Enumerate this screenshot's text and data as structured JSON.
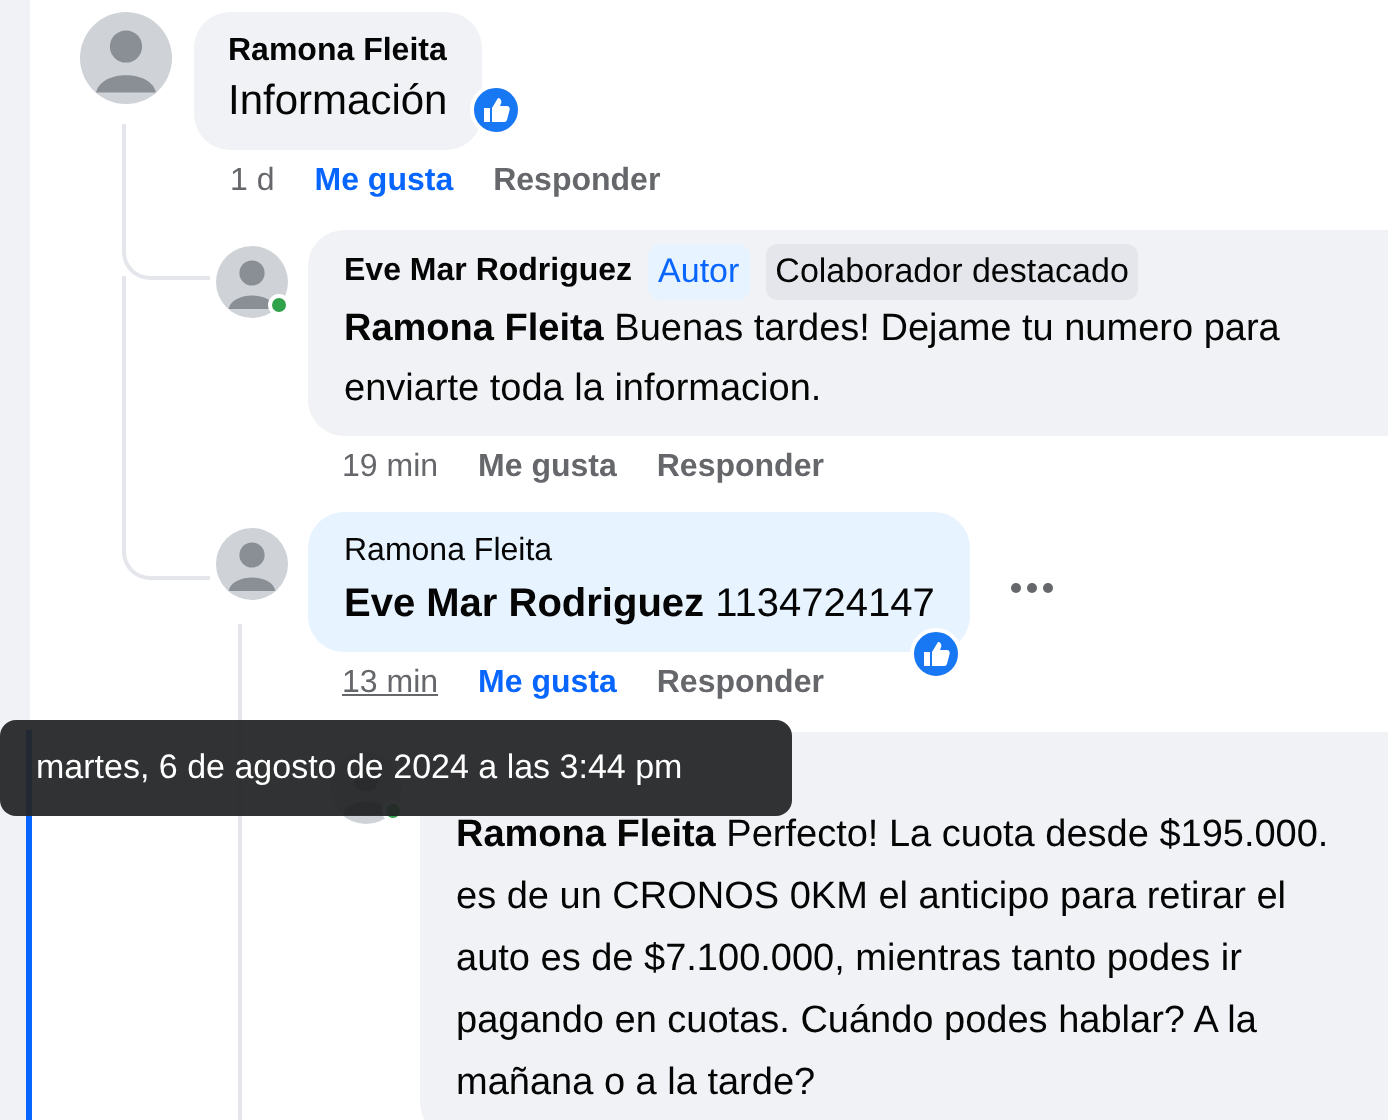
{
  "comments": [
    {
      "author": "Ramona Fleita",
      "text": "Información",
      "reacted": true,
      "time": "1 d",
      "like_label": "Me gusta",
      "liked": true,
      "reply_label": "Responder",
      "replies": [
        {
          "author": "Eve Mar Rodriguez",
          "badges": [
            {
              "label": "Autor",
              "kind": "author"
            },
            {
              "label": "Colaborador destacado",
              "kind": "contributor"
            }
          ],
          "mention": "Ramona Fleita",
          "text": "Buenas tardes! Dejame tu numero para enviarte toda la informacion.",
          "time": "19 min",
          "like_label": "Me gusta",
          "liked": false,
          "reply_label": "Responder",
          "online": true
        },
        {
          "author": "Ramona Fleita",
          "mention": "Eve Mar Rodriguez",
          "text": "1134724147",
          "reacted": true,
          "time": "13 min",
          "time_hovered": true,
          "like_label": "Me gusta",
          "liked": true,
          "reply_label": "Responder",
          "highlighted": true,
          "more_menu": true,
          "replies": [
            {
              "mention": "Ramona Fleita",
              "text": "Perfecto! La cuota desde $195.000. es de un CRONOS 0KM el anticipo para retirar el auto es de $7.100.000, mientras tanto podes ir pagando en cuotas. Cuándo podes hablar? A la mañana o a la tarde?",
              "online": true
            }
          ]
        }
      ]
    }
  ],
  "tooltip": {
    "text": "martes, 6 de agosto de 2024 a las 3:44 pm"
  }
}
